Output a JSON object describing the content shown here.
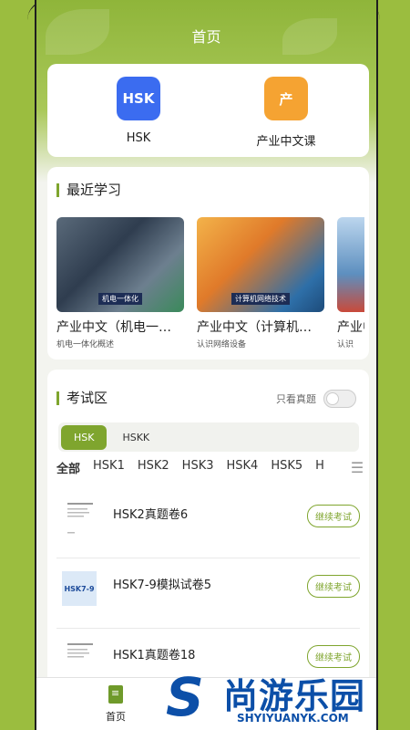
{
  "header": {
    "title": "首页"
  },
  "quick_links": [
    {
      "label": "HSK",
      "icon_text": "HSK",
      "color": "#3b6cf0"
    },
    {
      "label": "产业中文课",
      "icon_text": "产",
      "color": "#f5a332"
    }
  ],
  "recent": {
    "title": "最近学习",
    "courses": [
      {
        "title": "产业中文（机电一体化）",
        "subtitle": "机电一体化概述",
        "tag": "机电一体化"
      },
      {
        "title": "产业中文（计算机网络技术）",
        "subtitle": "认识网络设备",
        "tag": "计算机网络技术"
      },
      {
        "title": "产业中文",
        "subtitle": "认识"
      }
    ]
  },
  "exam": {
    "title": "考试区",
    "toggle_label": "只看真题",
    "categories": [
      "HSK",
      "HSKK"
    ],
    "levels": [
      "全部",
      "HSK1",
      "HSK2",
      "HSK3",
      "HSK4",
      "HSK5",
      "H"
    ],
    "papers": [
      {
        "name": "HSK2真题卷6",
        "button": "继续考试"
      },
      {
        "name": "HSK7-9模拟试卷5",
        "button": "继续考试",
        "thumb_text": "HSK7-9"
      },
      {
        "name": "HSK1真题卷18",
        "button": "继续考试"
      }
    ]
  },
  "tabbar": {
    "home_label": "首页"
  },
  "watermark": {
    "brand": "尚游乐园",
    "url": "SHYIYUANYK.COM",
    "logo": "S"
  },
  "colors": {
    "accent": "#7fa52e",
    "background": "#9bbd3f"
  }
}
